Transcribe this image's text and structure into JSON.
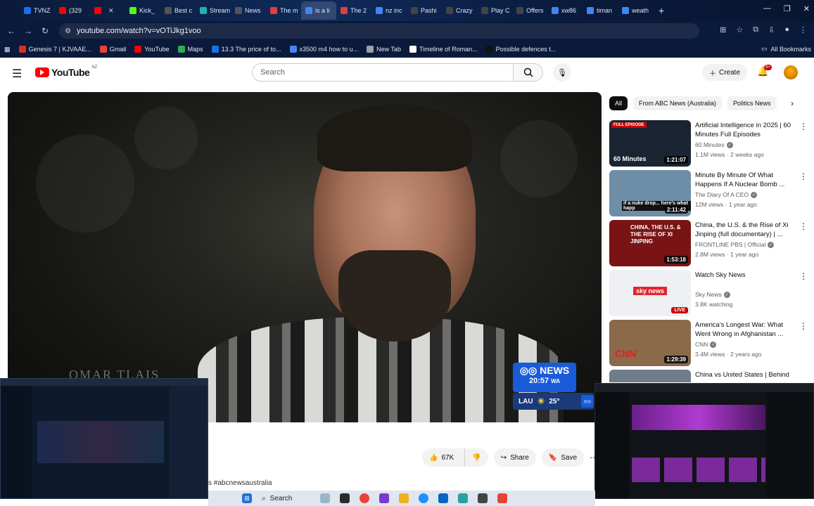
{
  "browser": {
    "tabs": [
      {
        "label": "TVNZ",
        "color": "#1c6cf2"
      },
      {
        "label": "(329",
        "color": "#ff0000"
      },
      {
        "label": "",
        "color": "#ff0000"
      },
      {
        "label": "Kick_",
        "color": "#53fc18"
      },
      {
        "label": "Best c",
        "color": "#555555"
      },
      {
        "label": "Stream",
        "color": "#20b2aa"
      },
      {
        "label": "News",
        "color": "#555555"
      },
      {
        "label": "The m",
        "color": "#e0403a"
      },
      {
        "label": "is a li",
        "color": "#4285f4"
      },
      {
        "label": "The 2",
        "color": "#e0403a"
      },
      {
        "label": "nz inc",
        "color": "#4285f4"
      },
      {
        "label": "Pashi",
        "color": "#444444"
      },
      {
        "label": "Crazy",
        "color": "#444444"
      },
      {
        "label": "Play C",
        "color": "#444444"
      },
      {
        "label": "Offers",
        "color": "#444444"
      },
      {
        "label": "xw86",
        "color": "#4285f4"
      },
      {
        "label": "timan",
        "color": "#4285f4"
      },
      {
        "label": "weath",
        "color": "#4285f4"
      }
    ],
    "active_tab_index": 8,
    "url": "youtube.com/watch?v=vOTiJkg1voo",
    "bookmarks": [
      {
        "label": "Genesis 7 | KJVAAE...",
        "color": "#d93025"
      },
      {
        "label": "Gmail",
        "color": "#ea4335"
      },
      {
        "label": "YouTube",
        "color": "#ff0000"
      },
      {
        "label": "Maps",
        "color": "#34a853"
      },
      {
        "label": "13.3 The price of to...",
        "color": "#1a73e8"
      },
      {
        "label": "x3500 m4 how to u...",
        "color": "#4285f4"
      },
      {
        "label": "New Tab",
        "color": "#9aa0a6"
      },
      {
        "label": "Timeline of Roman...",
        "color": "#ffffff"
      },
      {
        "label": "Possible defences t...",
        "color": "#111111"
      }
    ],
    "all_bookmarks": "All Bookmarks"
  },
  "youtube": {
    "logo_text": "YouTube",
    "country_code": "NZ",
    "search_placeholder": "Search",
    "create_label": "Create",
    "notif_count": "9+",
    "chips": [
      "All",
      "From ABC News (Australia)",
      "Politics News"
    ]
  },
  "video": {
    "lower_third": "OMAR TLAIS",
    "abc_brand": "NEWS",
    "abc_time": "20:57",
    "abc_tz": "WA",
    "location": "LAU",
    "temperature": "25°"
  },
  "actions": {
    "likes": "67K",
    "share": "Share",
    "save": "Save"
  },
  "description_tail": "s #abcnewsaustralia",
  "recommendations": [
    {
      "title": "Artificial Intelligence in 2025 | 60 Minutes Full Episodes",
      "channel": "60 Minutes",
      "verified": true,
      "meta": "1.1M views · 2 weeks ago",
      "duration": "1:21:07",
      "badge": "FULL EPISODE",
      "thumb": "60 Minutes",
      "bg": "#1b2433"
    },
    {
      "title": "Minute By Minute Of What Happens If A Nuclear Bomb ...",
      "channel": "The Diary Of A CEO",
      "verified": true,
      "meta": "12M views · 1 year ago",
      "duration": "2:11:42",
      "badge": "",
      "thumb": "if a nuke drop... here's what happ",
      "bg": "#6e8ea8"
    },
    {
      "title": "China, the U.S. & the Rise of Xi Jinping (full documentary) | ...",
      "channel": "FRONTLINE PBS | Official",
      "verified": true,
      "meta": "2.8M views · 1 year ago",
      "duration": "1:53:18",
      "badge": "",
      "thumb": "CHINA, THE U.S. & THE RISE OF XI JINPING",
      "bg": "#7a1414"
    },
    {
      "title": "Watch Sky News",
      "channel": "Sky News",
      "verified": true,
      "meta": "3.8K watching",
      "duration": "",
      "live": "LIVE",
      "badge": "",
      "thumb": "sky news",
      "bg": "#eef0f3"
    },
    {
      "title": "America's Longest War: What Went Wrong in Afghanistan ...",
      "channel": "CNN",
      "verified": true,
      "meta": "3.4M views · 2 years ago",
      "duration": "1:29:39",
      "badge": "",
      "thumb": "CNN",
      "bg": "#8b6a4a"
    },
    {
      "title": "China vs United States | Behind",
      "channel": "",
      "verified": false,
      "meta": "",
      "duration": "",
      "badge": "",
      "thumb": "",
      "bg": "#6f7c8a"
    }
  ],
  "taskbar": {
    "search_label": "Search"
  }
}
